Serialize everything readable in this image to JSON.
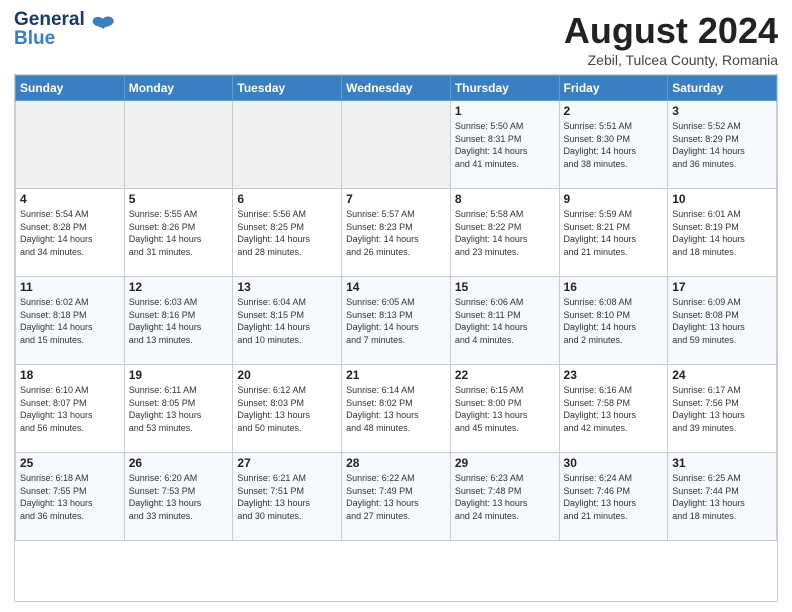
{
  "logo": {
    "line1": "General",
    "line2": "Blue"
  },
  "title": "August 2024",
  "subtitle": "Zebil, Tulcea County, Romania",
  "days_of_week": [
    "Sunday",
    "Monday",
    "Tuesday",
    "Wednesday",
    "Thursday",
    "Friday",
    "Saturday"
  ],
  "weeks": [
    [
      {
        "day": "",
        "info": ""
      },
      {
        "day": "",
        "info": ""
      },
      {
        "day": "",
        "info": ""
      },
      {
        "day": "",
        "info": ""
      },
      {
        "day": "1",
        "info": "Sunrise: 5:50 AM\nSunset: 8:31 PM\nDaylight: 14 hours\nand 41 minutes."
      },
      {
        "day": "2",
        "info": "Sunrise: 5:51 AM\nSunset: 8:30 PM\nDaylight: 14 hours\nand 38 minutes."
      },
      {
        "day": "3",
        "info": "Sunrise: 5:52 AM\nSunset: 8:29 PM\nDaylight: 14 hours\nand 36 minutes."
      }
    ],
    [
      {
        "day": "4",
        "info": "Sunrise: 5:54 AM\nSunset: 8:28 PM\nDaylight: 14 hours\nand 34 minutes."
      },
      {
        "day": "5",
        "info": "Sunrise: 5:55 AM\nSunset: 8:26 PM\nDaylight: 14 hours\nand 31 minutes."
      },
      {
        "day": "6",
        "info": "Sunrise: 5:56 AM\nSunset: 8:25 PM\nDaylight: 14 hours\nand 28 minutes."
      },
      {
        "day": "7",
        "info": "Sunrise: 5:57 AM\nSunset: 8:23 PM\nDaylight: 14 hours\nand 26 minutes."
      },
      {
        "day": "8",
        "info": "Sunrise: 5:58 AM\nSunset: 8:22 PM\nDaylight: 14 hours\nand 23 minutes."
      },
      {
        "day": "9",
        "info": "Sunrise: 5:59 AM\nSunset: 8:21 PM\nDaylight: 14 hours\nand 21 minutes."
      },
      {
        "day": "10",
        "info": "Sunrise: 6:01 AM\nSunset: 8:19 PM\nDaylight: 14 hours\nand 18 minutes."
      }
    ],
    [
      {
        "day": "11",
        "info": "Sunrise: 6:02 AM\nSunset: 8:18 PM\nDaylight: 14 hours\nand 15 minutes."
      },
      {
        "day": "12",
        "info": "Sunrise: 6:03 AM\nSunset: 8:16 PM\nDaylight: 14 hours\nand 13 minutes."
      },
      {
        "day": "13",
        "info": "Sunrise: 6:04 AM\nSunset: 8:15 PM\nDaylight: 14 hours\nand 10 minutes."
      },
      {
        "day": "14",
        "info": "Sunrise: 6:05 AM\nSunset: 8:13 PM\nDaylight: 14 hours\nand 7 minutes."
      },
      {
        "day": "15",
        "info": "Sunrise: 6:06 AM\nSunset: 8:11 PM\nDaylight: 14 hours\nand 4 minutes."
      },
      {
        "day": "16",
        "info": "Sunrise: 6:08 AM\nSunset: 8:10 PM\nDaylight: 14 hours\nand 2 minutes."
      },
      {
        "day": "17",
        "info": "Sunrise: 6:09 AM\nSunset: 8:08 PM\nDaylight: 13 hours\nand 59 minutes."
      }
    ],
    [
      {
        "day": "18",
        "info": "Sunrise: 6:10 AM\nSunset: 8:07 PM\nDaylight: 13 hours\nand 56 minutes."
      },
      {
        "day": "19",
        "info": "Sunrise: 6:11 AM\nSunset: 8:05 PM\nDaylight: 13 hours\nand 53 minutes."
      },
      {
        "day": "20",
        "info": "Sunrise: 6:12 AM\nSunset: 8:03 PM\nDaylight: 13 hours\nand 50 minutes."
      },
      {
        "day": "21",
        "info": "Sunrise: 6:14 AM\nSunset: 8:02 PM\nDaylight: 13 hours\nand 48 minutes."
      },
      {
        "day": "22",
        "info": "Sunrise: 6:15 AM\nSunset: 8:00 PM\nDaylight: 13 hours\nand 45 minutes."
      },
      {
        "day": "23",
        "info": "Sunrise: 6:16 AM\nSunset: 7:58 PM\nDaylight: 13 hours\nand 42 minutes."
      },
      {
        "day": "24",
        "info": "Sunrise: 6:17 AM\nSunset: 7:56 PM\nDaylight: 13 hours\nand 39 minutes."
      }
    ],
    [
      {
        "day": "25",
        "info": "Sunrise: 6:18 AM\nSunset: 7:55 PM\nDaylight: 13 hours\nand 36 minutes."
      },
      {
        "day": "26",
        "info": "Sunrise: 6:20 AM\nSunset: 7:53 PM\nDaylight: 13 hours\nand 33 minutes."
      },
      {
        "day": "27",
        "info": "Sunrise: 6:21 AM\nSunset: 7:51 PM\nDaylight: 13 hours\nand 30 minutes."
      },
      {
        "day": "28",
        "info": "Sunrise: 6:22 AM\nSunset: 7:49 PM\nDaylight: 13 hours\nand 27 minutes."
      },
      {
        "day": "29",
        "info": "Sunrise: 6:23 AM\nSunset: 7:48 PM\nDaylight: 13 hours\nand 24 minutes."
      },
      {
        "day": "30",
        "info": "Sunrise: 6:24 AM\nSunset: 7:46 PM\nDaylight: 13 hours\nand 21 minutes."
      },
      {
        "day": "31",
        "info": "Sunrise: 6:25 AM\nSunset: 7:44 PM\nDaylight: 13 hours\nand 18 minutes."
      }
    ]
  ]
}
